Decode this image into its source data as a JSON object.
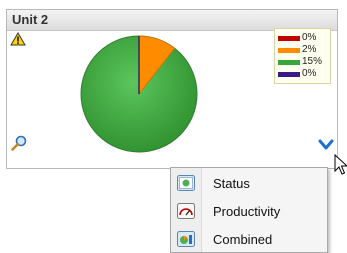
{
  "panel": {
    "title": "Unit 2",
    "legend": [
      {
        "label": "0%",
        "color": "#c00000"
      },
      {
        "label": "2%",
        "color": "#ff8c00"
      },
      {
        "label": "15%",
        "color": "#3aa53a"
      },
      {
        "label": "0%",
        "color": "#3a1a8a"
      }
    ],
    "pie_colors": {
      "main": "#3aa53a",
      "slice": "#ff8c00",
      "line": "#2a2a6a"
    }
  },
  "menu": {
    "items": [
      {
        "label": "Status",
        "icon": "status-icon"
      },
      {
        "label": "Productivity",
        "icon": "productivity-gauge-icon"
      },
      {
        "label": "Combined",
        "icon": "combined-icon"
      }
    ]
  },
  "icons": {
    "warning": "warning-icon",
    "zoom": "magnifier-icon",
    "expand": "chevron-down-icon"
  }
}
